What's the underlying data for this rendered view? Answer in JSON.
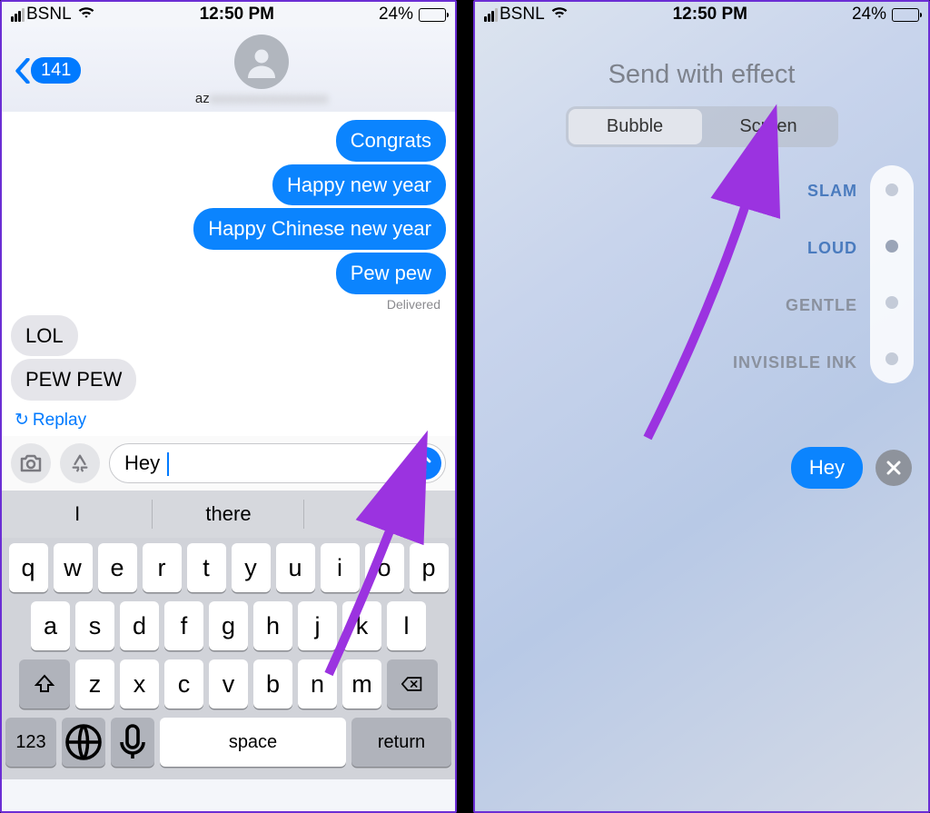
{
  "status": {
    "carrier": "BSNL",
    "time": "12:50 PM",
    "battery_pct": "24%"
  },
  "chat": {
    "back_count": "141",
    "contact_prefix": "az",
    "messages_out": [
      "Congrats",
      "Happy new year",
      "Happy Chinese new year",
      "Pew pew"
    ],
    "delivered": "Delivered",
    "messages_in": [
      "LOL",
      "PEW PEW"
    ],
    "replay": "Replay",
    "compose_value": "Hey ",
    "suggestions": [
      "I",
      "there",
      ""
    ],
    "kbd_r1": [
      "q",
      "w",
      "e",
      "r",
      "t",
      "y",
      "u",
      "i",
      "o",
      "p"
    ],
    "kbd_r2": [
      "a",
      "s",
      "d",
      "f",
      "g",
      "h",
      "j",
      "k",
      "l"
    ],
    "kbd_r3": [
      "z",
      "x",
      "c",
      "v",
      "b",
      "n",
      "m"
    ],
    "k123": "123",
    "kspace": "space",
    "kreturn": "return"
  },
  "effect": {
    "title": "Send with effect",
    "tabs": [
      "Bubble",
      "Screen"
    ],
    "options": [
      "SLAM",
      "LOUD",
      "GENTLE",
      "INVISIBLE INK"
    ],
    "bubble_text": "Hey"
  }
}
